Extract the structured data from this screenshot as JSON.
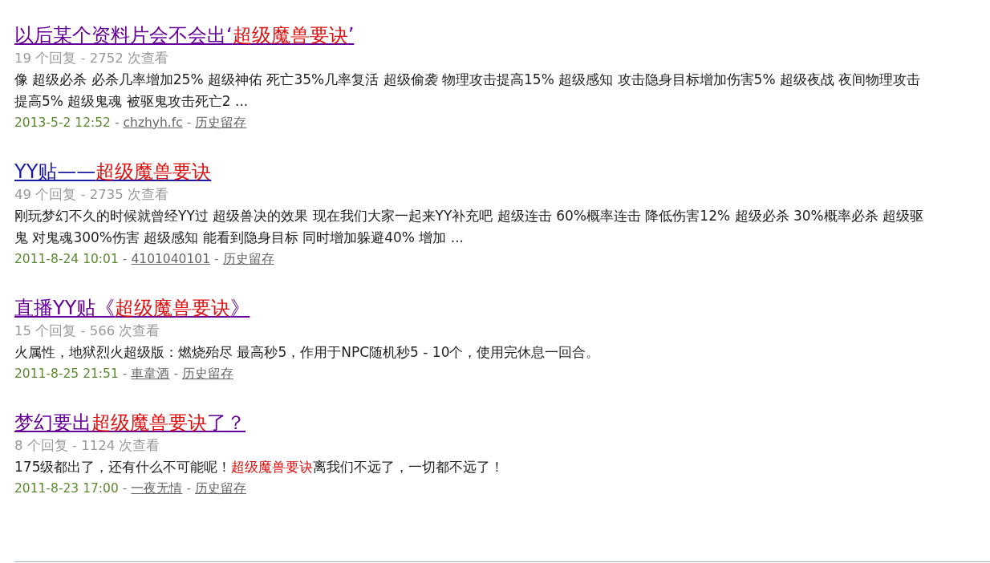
{
  "results": [
    {
      "title": [
        {
          "text": "以后某个资料片会不会出‘",
          "highlight": false
        },
        {
          "text": "超级魔兽要诀",
          "highlight": true
        },
        {
          "text": "’",
          "highlight": false
        }
      ],
      "visited": true,
      "stats": "19 个回复 - 2752 次查看",
      "snippet": [
        {
          "text": "像 超级必杀 必杀几率增加25% 超级神佑 死亡35%几率复活 超级偷袭 物理攻击提高15% 超级感知 攻击隐身目标增加伤害5% 超级夜战 夜间物理攻击提高5% 超级鬼魂 被驱鬼攻击死亡2 ...",
          "highlight": false
        }
      ],
      "date": "2013-5-2 12:52",
      "sep": "-",
      "author": "chzhyh.fc",
      "archive": "历史留存"
    },
    {
      "title": [
        {
          "text": "YY贴——",
          "highlight": false
        },
        {
          "text": "超级魔兽要诀",
          "highlight": true
        }
      ],
      "visited": false,
      "stats": "49 个回复 - 2735 次查看",
      "snippet": [
        {
          "text": "刚玩梦幻不久的时候就曾经YY过 超级兽决的效果 现在我们大家一起来YY补充吧 超级连击 60%概率连击 降低伤害12% 超级必杀 30%概率必杀 超级驱鬼 对鬼魂300%伤害 超级感知 能看到隐身目标 同时增加躲避40% 增加 ...",
          "highlight": false
        }
      ],
      "date": "2011-8-24 10:01",
      "sep": "-",
      "author": "4101040101",
      "archive": "历史留存"
    },
    {
      "title": [
        {
          "text": "直播YY贴《",
          "highlight": false
        },
        {
          "text": "超级魔兽要诀",
          "highlight": true
        },
        {
          "text": "》",
          "highlight": false
        }
      ],
      "visited": true,
      "stats": "15 个回复 - 566 次查看",
      "snippet": [
        {
          "text": "火属性，地狱烈火超级版：燃烧殆尽 最高秒5，作用于NPC随机秒5 - 10个，使用完休息一回合。",
          "highlight": false
        }
      ],
      "date": "2011-8-25 21:51",
      "sep": "-",
      "author": "車韋酒",
      "archive": "历史留存"
    },
    {
      "title": [
        {
          "text": "梦幻要出",
          "highlight": false
        },
        {
          "text": "超级魔兽要诀",
          "highlight": true
        },
        {
          "text": "了？",
          "highlight": false
        }
      ],
      "visited": true,
      "stats": "8 个回复 - 1124 次查看",
      "snippet": [
        {
          "text": "175级都出了，还有什么不可能呢！",
          "highlight": false
        },
        {
          "text": "超级魔兽要诀",
          "highlight": true
        },
        {
          "text": "离我们不远了，一切都不远了！",
          "highlight": false
        }
      ],
      "date": "2011-8-23 17:00",
      "sep": "-",
      "author": "一夜无情",
      "archive": "历史留存"
    }
  ]
}
